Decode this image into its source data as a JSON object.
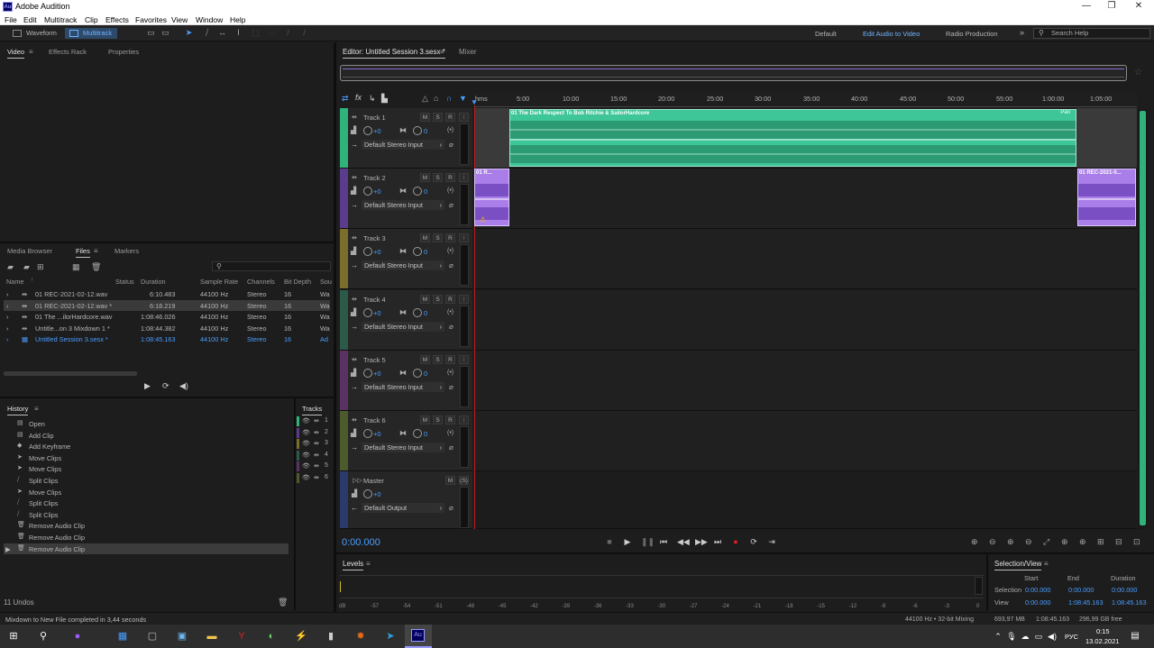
{
  "window": {
    "title": "Adobe Audition"
  },
  "menu": [
    "File",
    "Edit",
    "Multitrack",
    "Clip",
    "Effects",
    "Favorites",
    "View",
    "Window",
    "Help"
  ],
  "toolbar": {
    "waveform": "Waveform",
    "multitrack": "Multitrack",
    "workspaces": [
      "Default",
      "Edit Audio to Video",
      "Radio Production"
    ],
    "search_placeholder": "Search Help"
  },
  "video_panel": {
    "tabs": [
      "Video",
      "Effects Rack",
      "Properties"
    ]
  },
  "files_panel": {
    "tabs": [
      "Media Browser",
      "Files",
      "Markers"
    ],
    "search_icon": "magnifier-icon",
    "columns": [
      "Name",
      "Status",
      "Duration",
      "Sample Rate",
      "Channels",
      "Bit Depth",
      "Sou"
    ],
    "rows": [
      {
        "name": "01 REC-2021-02-12.wav",
        "duration": "6:10.483",
        "rate": "44100 Hz",
        "ch": "Stereo",
        "bits": "16",
        "src": "Wa"
      },
      {
        "name": "01 REC-2021-02-12.wav *",
        "duration": "6:18.219",
        "rate": "44100 Hz",
        "ch": "Stereo",
        "bits": "16",
        "src": "Wa"
      },
      {
        "name": "01 The ...ilorHardcore.wav",
        "duration": "1:08:46.026",
        "rate": "44100 Hz",
        "ch": "Stereo",
        "bits": "16",
        "src": "Wa"
      },
      {
        "name": "Untitle...on 3 Mixdown 1 *",
        "duration": "1:08:44.382",
        "rate": "44100 Hz",
        "ch": "Stereo",
        "bits": "16",
        "src": "Wa"
      },
      {
        "name": "Untitled Session 3.sesx *",
        "duration": "1:08:45.163",
        "rate": "44100 Hz",
        "ch": "Stereo",
        "bits": "16",
        "src": "Ad"
      }
    ]
  },
  "history": {
    "title": "History",
    "items": [
      "Open",
      "Add Clip",
      "Add Keyframe",
      "Move Clips",
      "Move Clips",
      "Split Clips",
      "Move Clips",
      "Split Clips",
      "Split Clips",
      "Remove Audio Clip",
      "Remove Audio Clip",
      "Remove Audio Clip"
    ],
    "undos": "11 Undos"
  },
  "tracks_panel": {
    "title": "Tracks",
    "items": [
      "1",
      "2",
      "3",
      "4",
      "5",
      "6"
    ]
  },
  "editor": {
    "tab": "Editor: Untitled Session 3.sesx *",
    "mixer": "Mixer",
    "ruler": [
      "hms",
      "5:00",
      "10:00",
      "15:00",
      "20:00",
      "25:00",
      "30:00",
      "35:00",
      "40:00",
      "45:00",
      "50:00",
      "55:00",
      "1:00:00",
      "1:05:00"
    ],
    "time": "0:00.000"
  },
  "tracks": [
    {
      "name": "Track 1",
      "vol": "+0",
      "pan": "0",
      "input": "Default Stereo Input",
      "color": "#2fb37a"
    },
    {
      "name": "Track 2",
      "vol": "+0",
      "pan": "0",
      "input": "Default Stereo Input",
      "color": "#5b3b8c"
    },
    {
      "name": "Track 3",
      "vol": "+0",
      "pan": "0",
      "input": "Default Stereo Input",
      "color": "#7b6e2a"
    },
    {
      "name": "Track 4",
      "vol": "+0",
      "pan": "0",
      "input": "Default Stereo Input",
      "color": "#2c5a48"
    },
    {
      "name": "Track 5",
      "vol": "+0",
      "pan": "0",
      "input": "Default Stereo Input",
      "color": "#5a3262"
    },
    {
      "name": "Track 6",
      "vol": "+0",
      "pan": "0",
      "input": "Default Stereo Input",
      "color": "#4c5a2c"
    }
  ],
  "master": {
    "name": "Master",
    "vol": "+0",
    "output": "Default Output"
  },
  "clips": {
    "track1": "01 The Dark Respect To Bob Ritchie & SailorHardcore",
    "track1_tag": "Pan",
    "track2a": "01 R...",
    "track2b": "01 REC-2021-0..."
  },
  "levels": {
    "title": "Levels",
    "scale": [
      "dB",
      "-57",
      "-54",
      "-51",
      "-48",
      "-45",
      "-42",
      "-39",
      "-36",
      "-33",
      "-30",
      "-27",
      "-24",
      "-21",
      "-18",
      "-15",
      "-12",
      "-9",
      "-6",
      "-3",
      "0"
    ]
  },
  "selection_view": {
    "title": "Selection/View",
    "headers": [
      "Start",
      "End",
      "Duration"
    ],
    "selection": {
      "label": "Selection",
      "start": "0:00.000",
      "end": "0:00.000",
      "duration": "0:00.000"
    },
    "view": {
      "label": "View",
      "start": "0:00.000",
      "end": "1:08:45.163",
      "duration": "1:08:45.163"
    }
  },
  "status": {
    "message": "Mixdown to New File completed in 3,44 seconds",
    "format": "44100 Hz • 32-bit Mixing",
    "mem": "693,97 MB",
    "dur": "1:08:45.163",
    "free": "296,99 GB free"
  },
  "taskbar": {
    "lang": "РУС",
    "time": "0:15",
    "date": "13.02.2021"
  }
}
